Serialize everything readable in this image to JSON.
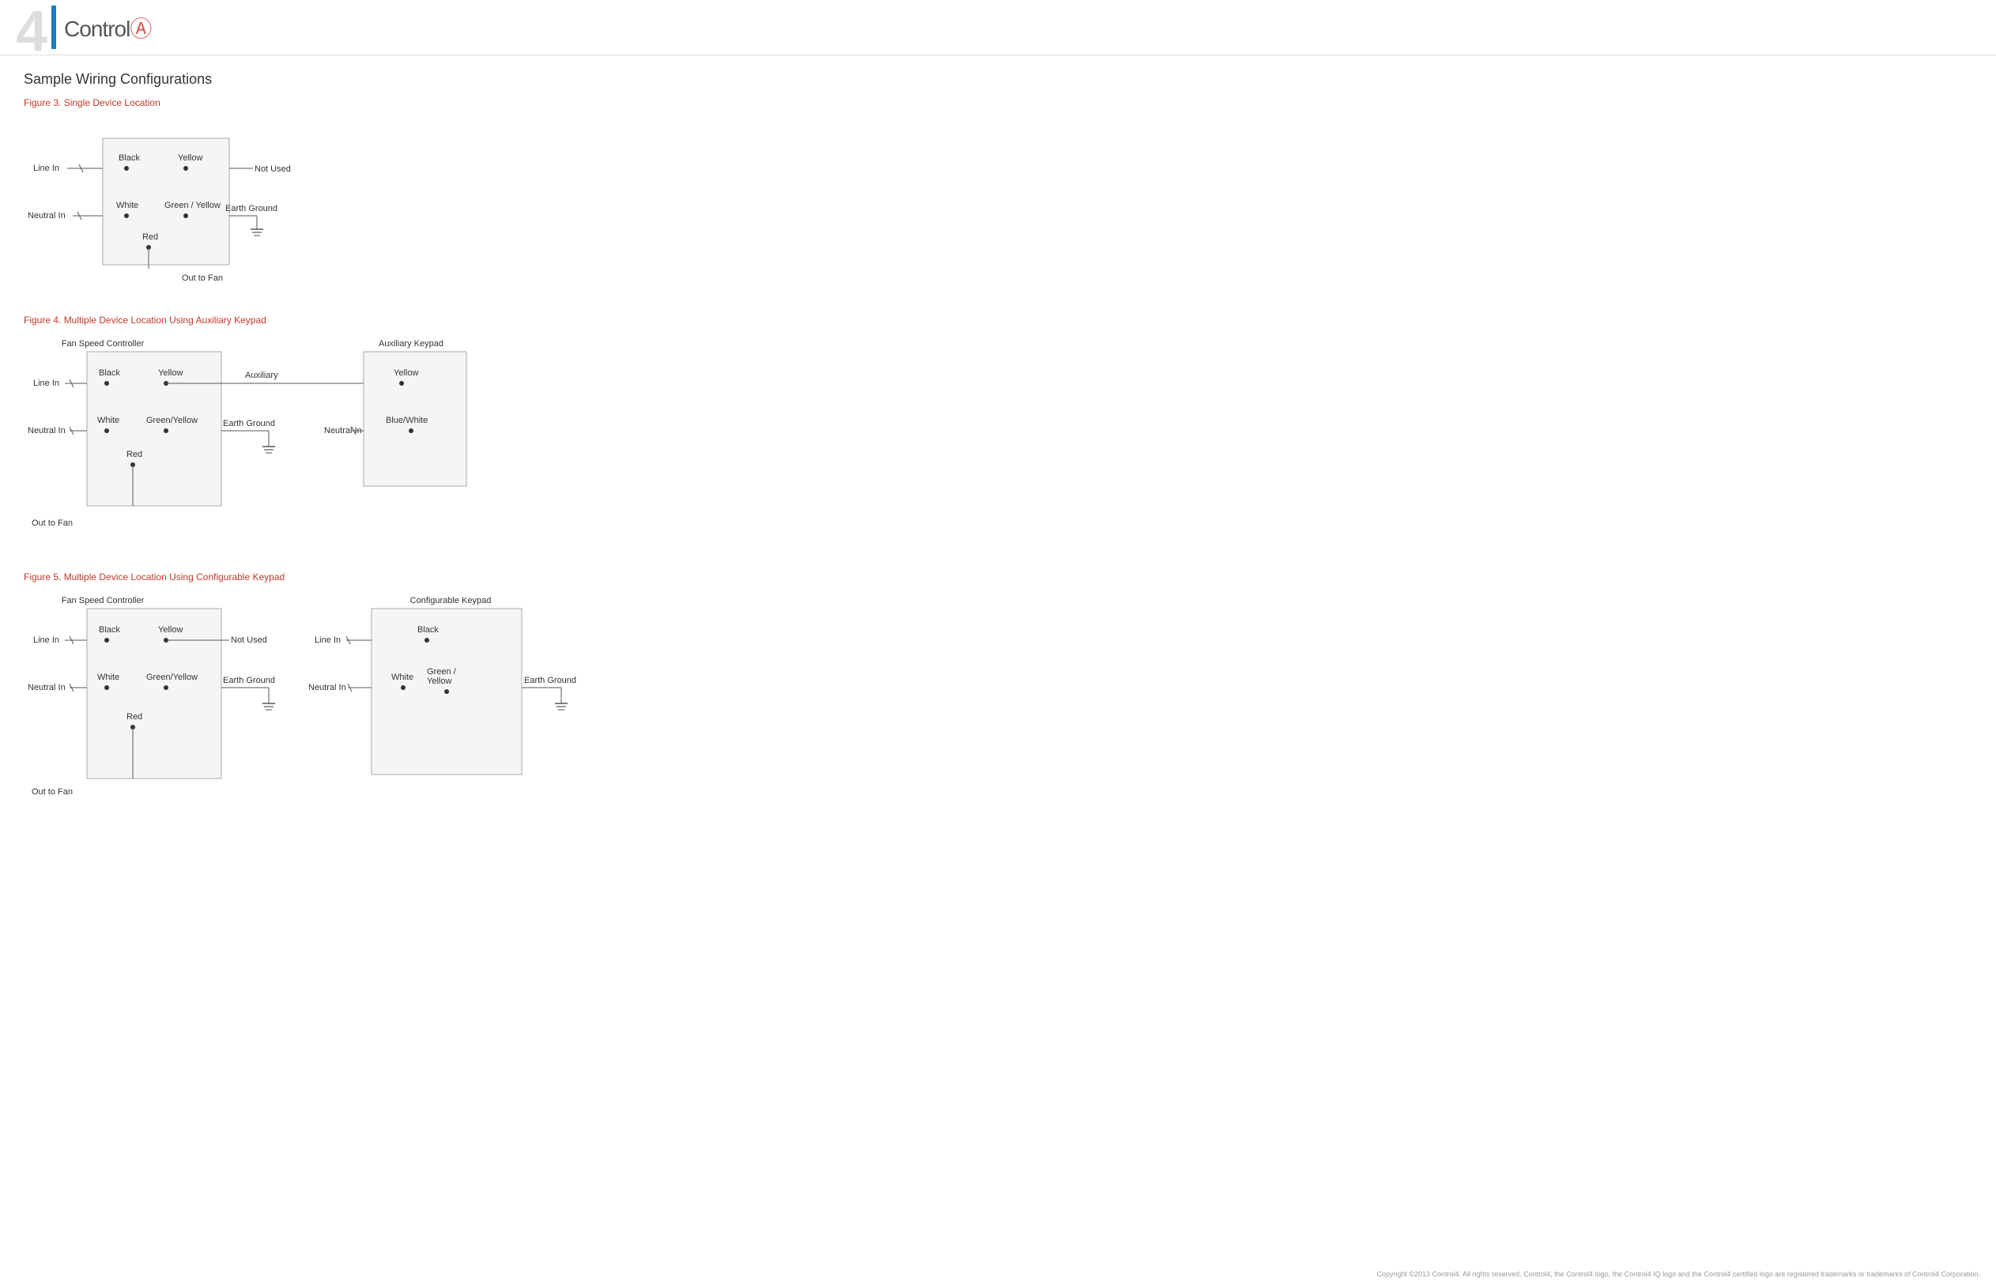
{
  "header": {
    "logo_number": "4",
    "logo_text": "Control",
    "logo_symbol": "4"
  },
  "page": {
    "title": "Sample Wiring Configurations"
  },
  "figures": [
    {
      "label": "Figure 3. Single Device Location",
      "diagram": "single"
    },
    {
      "label": "Figure 4. Multiple Device Location Using Auxiliary Keypad",
      "diagram": "auxiliary"
    },
    {
      "label": "Figure 5. Multiple Device Location Using Configurable Keypad",
      "diagram": "configurable"
    }
  ],
  "footer": {
    "copyright": "Copyright ©2013 Control4. All rights reserved. Control4, the Control4 logo, the Control4 IQ logo and the Control4 certified logo are registered trademarks or trademarks of Control4 Corporation."
  }
}
